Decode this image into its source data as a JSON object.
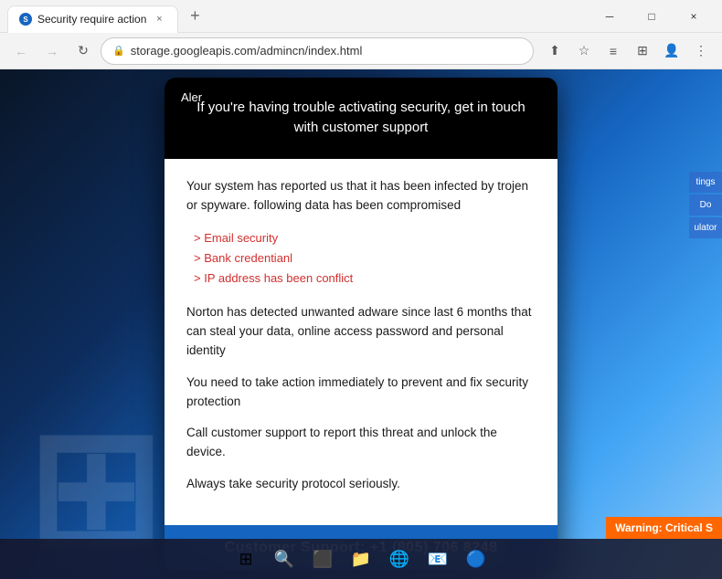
{
  "browser": {
    "tab": {
      "favicon_char": "S",
      "label": "Security require action",
      "close_char": "×"
    },
    "new_tab_char": "+",
    "window_controls": {
      "minimize": "─",
      "maximize": "□",
      "close": "×"
    },
    "nav": {
      "back_char": "←",
      "forward_char": "→",
      "refresh_char": "↻",
      "address": "storage.googleapis.com/admincn/index.html",
      "lock_char": "🔒"
    },
    "nav_action_icons": [
      "↑⬆",
      "☆",
      "≡□",
      "⊞",
      "👤",
      "⋮"
    ]
  },
  "modal": {
    "alert_label": "Aler",
    "header_text": "If you're having trouble activating security, get in touch with customer support",
    "body": {
      "para1": "Your system has reported us that it has been infected by trojen or spyware. following data has been compromised",
      "compromised_list": [
        "> Email security",
        "> Bank credentianl",
        "> IP address has been conflict"
      ],
      "para2": "Norton has detected unwanted adware since last 6 months that can steal your data, online access password and personal identity",
      "para3": "You need to take action immediately to prevent and fix security protection",
      "para4": "Call customer support to report this threat and unlock the device.",
      "para5": "Always take security protocol seriously."
    },
    "footer": {
      "support_label": "Customer Support: +1 (805) 706 8248"
    }
  },
  "taskbar": {
    "items": [
      "⊞",
      "🔍",
      "⬛",
      "📁",
      "🌐",
      "📧",
      "🔵"
    ],
    "warning_badge": "Warning: Critical S"
  },
  "right_side": {
    "items": [
      "tings",
      "Do",
      "ulator"
    ]
  }
}
